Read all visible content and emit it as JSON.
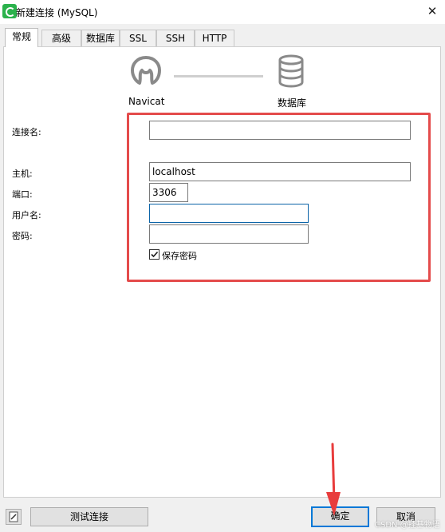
{
  "window": {
    "title": "新建连接 (MySQL)",
    "close_glyph": "✕"
  },
  "tabs": [
    {
      "label": "常规",
      "active": true
    },
    {
      "label": "高级"
    },
    {
      "label": "数据库"
    },
    {
      "label": "SSL"
    },
    {
      "label": "SSH"
    },
    {
      "label": "HTTP"
    }
  ],
  "diagram": {
    "left_label": "Navicat",
    "right_label": "数据库"
  },
  "form": {
    "connection_name": {
      "label": "连接名:",
      "value": ""
    },
    "host": {
      "label": "主机:",
      "value": "localhost"
    },
    "port": {
      "label": "端口:",
      "value": "3306"
    },
    "username": {
      "label": "用户名:",
      "value": ""
    },
    "password": {
      "label": "密码:",
      "value": ""
    },
    "save_password": {
      "label": "保存密码",
      "checked": true
    }
  },
  "footer": {
    "test_label": "测试连接",
    "ok_label": "确定",
    "cancel_label": "取消"
  },
  "watermark": "CSDN @挂基物语",
  "colors": {
    "highlight_box": "#e44b4b",
    "arrow": "#e83c3c",
    "focus": "#0c64a8",
    "primary_border": "#0078d7"
  }
}
